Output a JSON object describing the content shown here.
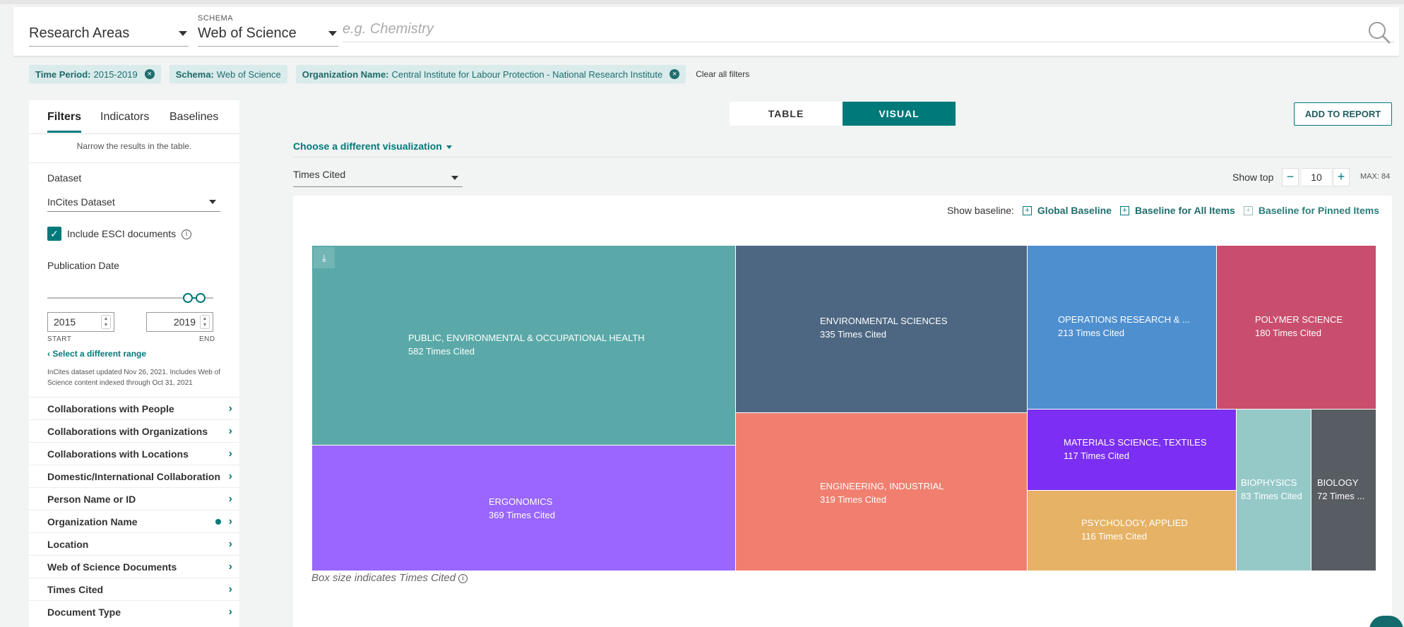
{
  "search": {
    "category_select": "Research Areas",
    "schema_label": "SCHEMA",
    "schema_select": "Web of Science",
    "placeholder": "e.g. Chemistry"
  },
  "chips": [
    {
      "key": "Time Period:",
      "value": "2015-2019",
      "removable": true
    },
    {
      "key": "Schema:",
      "value": "Web of Science",
      "removable": false
    },
    {
      "key": "Organization Name:",
      "value": "Central Institute for Labour Protection - National Research Institute",
      "removable": true
    }
  ],
  "clear_all": "Clear all filters",
  "left": {
    "tabs": [
      "Filters",
      "Indicators",
      "Baselines"
    ],
    "hint": "Narrow the results in the table.",
    "dataset_label": "Dataset",
    "dataset_value": "InCites Dataset",
    "esci_label": "Include ESCI documents",
    "pubdate_label": "Publication Date",
    "start_year": "2015",
    "end_year": "2019",
    "start_label": "START",
    "end_label": "END",
    "range_link": "Select a different range",
    "note": "InCites dataset updated Nov 26, 2021. Includes Web of Science content indexed through Oct 31, 2021",
    "filters": [
      {
        "label": "Collaborations with People",
        "active": false
      },
      {
        "label": "Collaborations with Organizations",
        "active": false
      },
      {
        "label": "Collaborations with Locations",
        "active": false
      },
      {
        "label": "Domestic/International Collaboration",
        "active": false
      },
      {
        "label": "Person Name or ID",
        "active": false
      },
      {
        "label": "Organization Name",
        "active": true
      },
      {
        "label": "Location",
        "active": false
      },
      {
        "label": "Web of Science Documents",
        "active": false
      },
      {
        "label": "Times Cited",
        "active": false
      },
      {
        "label": "Document Type",
        "active": false
      }
    ]
  },
  "view": {
    "table_label": "TABLE",
    "visual_label": "VISUAL",
    "add_report": "ADD TO REPORT",
    "choose_viz": "Choose a different visualization",
    "metric": "Times Cited",
    "show_top_label": "Show top",
    "show_top_value": "10",
    "max_label": "MAX: 84",
    "baseline_label": "Show baseline:",
    "baselines": [
      "Global Baseline",
      "Baseline for All Items",
      "Baseline for Pinned Items"
    ],
    "caption": "Box size indicates Times Cited"
  },
  "chart_data": {
    "type": "treemap",
    "metric": "Times Cited",
    "items": [
      {
        "name": "PUBLIC, ENVIRONMENTAL & OCCUPATIONAL HEALTH",
        "value": 582,
        "label": "582 Times Cited",
        "color": "#5aa9a8"
      },
      {
        "name": "ERGONOMICS",
        "value": 369,
        "label": "369 Times Cited",
        "color": "#9966ff"
      },
      {
        "name": "ENVIRONMENTAL SCIENCES",
        "value": 335,
        "label": "335 Times Cited",
        "color": "#4d6782"
      },
      {
        "name": "ENGINEERING, INDUSTRIAL",
        "value": 319,
        "label": "319 Times Cited",
        "color": "#f07f6f"
      },
      {
        "name": "OPERATIONS RESEARCH & ...",
        "value": 213,
        "label": "213 Times Cited",
        "color": "#4e8fd0"
      },
      {
        "name": "POLYMER SCIENCE",
        "value": 180,
        "label": "180 Times Cited",
        "color": "#c94e6d"
      },
      {
        "name": "MATERIALS SCIENCE, TEXTILES",
        "value": 117,
        "label": "117 Times Cited",
        "color": "#7b2ff2"
      },
      {
        "name": "PSYCHOLOGY, APPLIED",
        "value": 116,
        "label": "116 Times Cited",
        "color": "#e6b266"
      },
      {
        "name": "BIOPHYSICS",
        "value": 83,
        "label": "83 Times Cited",
        "color": "#95c9c8"
      },
      {
        "name": "BIOLOGY",
        "value": 72,
        "label": "72 Times ...",
        "color": "#585c63"
      }
    ]
  }
}
